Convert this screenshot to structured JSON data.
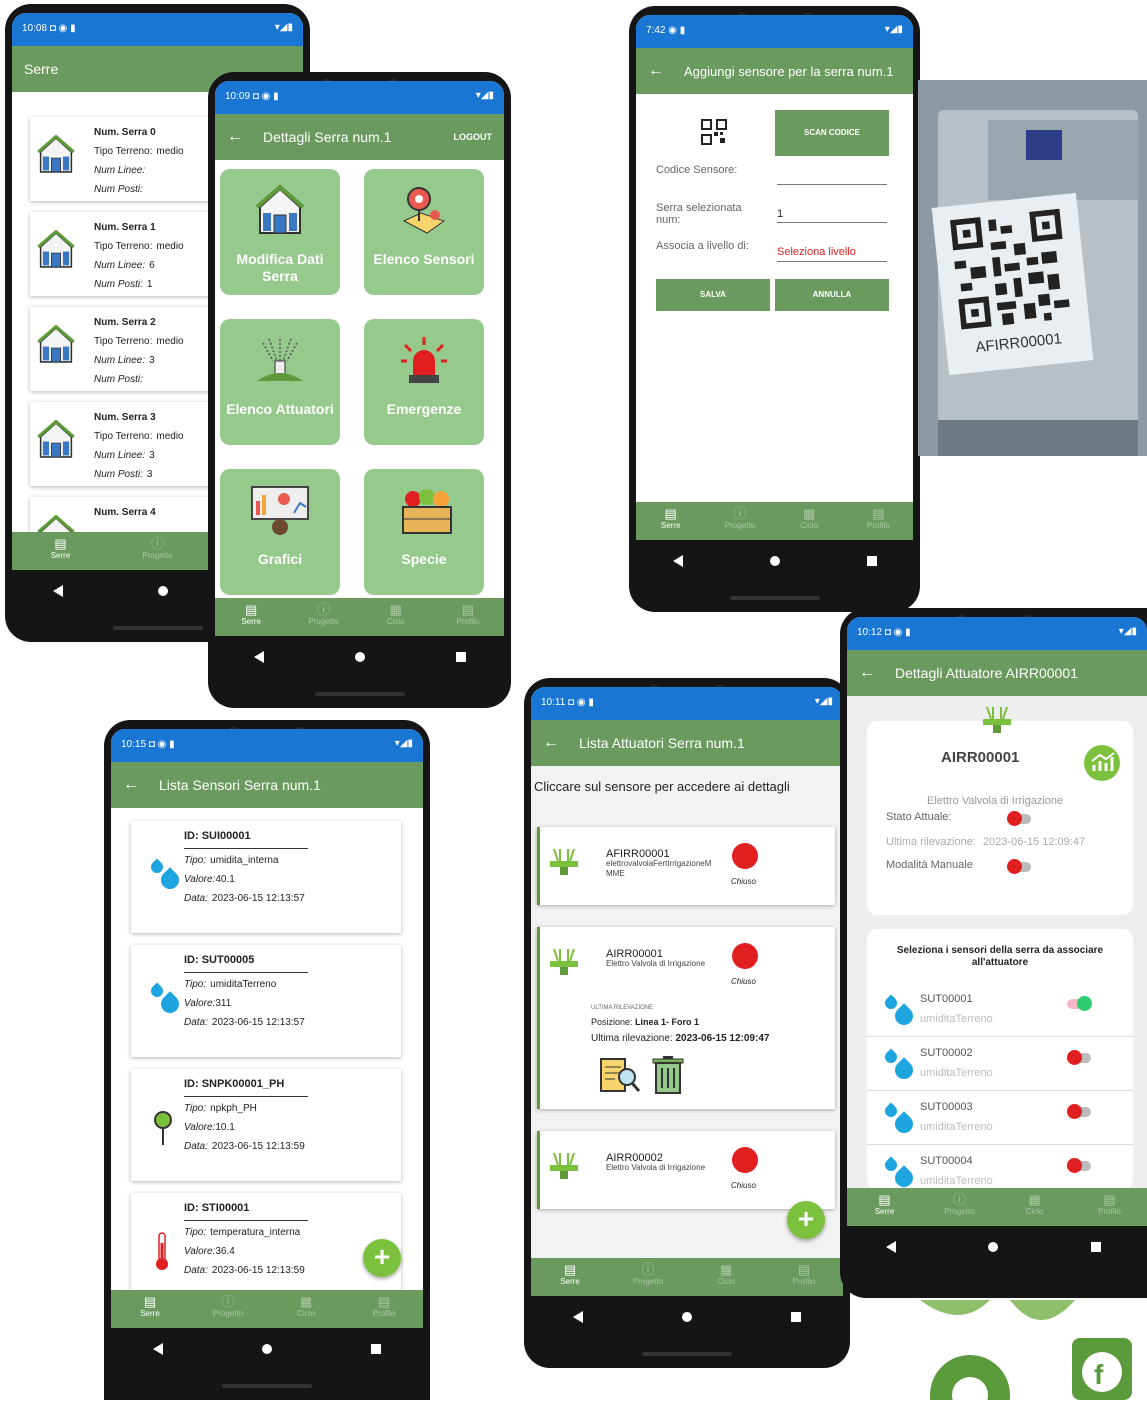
{
  "p1": {
    "time": "10:08",
    "title": "Serre",
    "cards": [
      {
        "name": "Num. Serra 0",
        "tipo": "Tipo Terreno:",
        "tv": "medio",
        "linee": "Num Linee:",
        "lv": "",
        "posti": "Num Posti:",
        "pv": ""
      },
      {
        "name": "Num. Serra 1",
        "tipo": "Tipo Terreno:",
        "tv": "medio",
        "linee": "Num Linee:",
        "lv": "6",
        "posti": "Num Posti:",
        "pv": "1"
      },
      {
        "name": "Num. Serra 2",
        "tipo": "Tipo Terreno:",
        "tv": "medio",
        "linee": "Num Linee:",
        "lv": "3",
        "posti": "Num Posti:",
        "pv": ""
      },
      {
        "name": "Num. Serra 3",
        "tipo": "Tipo Terreno:",
        "tv": "medio",
        "linee": "Num Linee:",
        "lv": "3",
        "posti": "Num Posti:",
        "pv": "3"
      },
      {
        "name": "Num. Serra 4"
      }
    ]
  },
  "nav": {
    "serre": "Serre",
    "progetto": "Progetto",
    "ciclo": "Ciclo",
    "profilo": "Profilo"
  },
  "p2": {
    "time": "10:09",
    "title": "Dettagli Serra num.1",
    "logout": "LOGOUT",
    "tiles": [
      "Modifica Dati Serra",
      "Elenco Sensori",
      "Elenco Attuatori",
      "Emergenze",
      "Grafici",
      "Specie"
    ]
  },
  "p3": {
    "time": "7:42",
    "title": "Aggiungi sensore per la serra num.1",
    "scan": "SCAN CODICE",
    "codice": "Codice Sensore:",
    "serra": "Serra selezionata num:",
    "serra_val": "1",
    "assoc": "Associa a livello di:",
    "livello": "Seleziona livello",
    "salva": "SALVA",
    "annulla": "ANNULLA"
  },
  "photo": {
    "label": "AFIRR00001"
  },
  "p4": {
    "time": "10:15",
    "title": "Lista Sensori Serra num.1",
    "tipo": "Tipo:",
    "valore": "Valore:",
    "data": "Data:",
    "sensors": [
      {
        "id": "ID: SUI00001",
        "tipo": "umidita_interna",
        "valore": "40.1",
        "data": "2023-06-15 12:13:57"
      },
      {
        "id": "ID: SUT00005",
        "tipo": "umiditaTerreno",
        "valore": "311",
        "data": "2023-06-15 12:13:57"
      },
      {
        "id": "ID: SNPK00001_PH",
        "tipo": "npkph_PH",
        "valore": "10.1",
        "data": "2023-06-15 12:13:59"
      },
      {
        "id": "ID: STI00001",
        "tipo": "temperatura_interna",
        "valore": "36.4",
        "data": "2023-06-15 12:13:59"
      }
    ]
  },
  "p5": {
    "time": "10:11",
    "title": "Lista Attuatori Serra num.1",
    "hint": "Cliccare sul sensore per accedere ai dettagli",
    "chiuso": "Chiuso",
    "items": [
      {
        "id": "AFIRR00001",
        "desc": "elettrovalvolaFertIrrigazioneMMME"
      },
      {
        "id": "AIRR00001",
        "desc": "Elettro Valvola di Irrigazione"
      },
      {
        "id": "AIRR00002",
        "desc": "Elettro Valvola di Irrigazione"
      }
    ],
    "ultima": "ULTIMA RILEVAZIONE",
    "pos_l": "Posizione:",
    "pos_v": "Linea 1- Foro 1",
    "ril_l": "Ultima rilevazione:",
    "ril_v": "2023-06-15 12:09:47"
  },
  "p6": {
    "time": "10:12",
    "title": "Dettagli Attuatore AIRR00001",
    "id": "AIRR00001",
    "desc": "Elettro Valvola di Irrigazione",
    "stato": "Stato Attuale:",
    "ultima": "Ultima rilevazione:",
    "ultima_v": "2023-06-15 12:09:47",
    "manuale": "Modalità Manuale",
    "sel": "Seleziona i sensori della serra da associare all'attuatore",
    "sensors": [
      {
        "id": "SUT00001",
        "tipo": "umiditaTerreno",
        "on": true
      },
      {
        "id": "SUT00002",
        "tipo": "umiditaTerreno",
        "on": false
      },
      {
        "id": "SUT00003",
        "tipo": "umiditaTerreno",
        "on": false
      },
      {
        "id": "SUT00004",
        "tipo": "umiditaTerreno",
        "on": false
      }
    ]
  },
  "colors": {
    "green": "#6b9a5f",
    "tile": "#96c98c",
    "status": "#1976d2",
    "red": "#e02020",
    "accent": "#7cc13d"
  }
}
